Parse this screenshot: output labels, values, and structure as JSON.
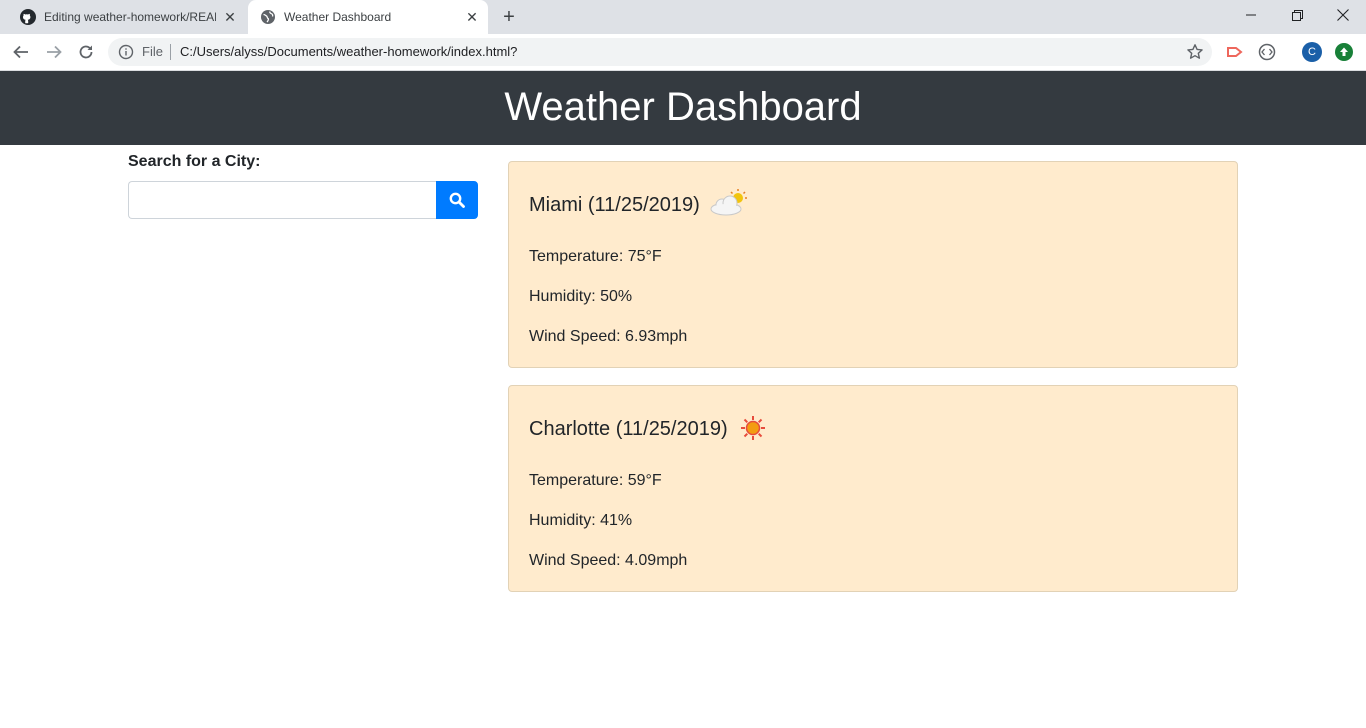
{
  "browser": {
    "tabs": [
      {
        "title": "Editing weather-homework/READ",
        "icon": "github-icon"
      },
      {
        "title": "Weather Dashboard",
        "icon": "globe-icon"
      }
    ],
    "new_tab_label": "+",
    "address": {
      "scheme_label": "File",
      "url": "C:/Users/alyss/Documents/weather-homework/index.html?"
    },
    "profile_initial": "C"
  },
  "page": {
    "title": "Weather Dashboard",
    "search": {
      "label": "Search for a City:",
      "value": "",
      "placeholder": "",
      "button_icon": "search-icon"
    },
    "cities": [
      {
        "title": "Miami (11/25/2019)",
        "icon": "partly-cloudy-icon",
        "temperature": "Temperature: 75°F",
        "humidity": "Humidity: 50%",
        "wind": "Wind Speed: 6.93mph"
      },
      {
        "title": "Charlotte (11/25/2019)",
        "icon": "sun-icon",
        "temperature": "Temperature: 59°F",
        "humidity": "Humidity: 41%",
        "wind": "Wind Speed: 4.09mph"
      }
    ]
  },
  "colors": {
    "header_bg": "#343a40",
    "card_bg": "#ffebcd",
    "accent": "#007bff"
  }
}
